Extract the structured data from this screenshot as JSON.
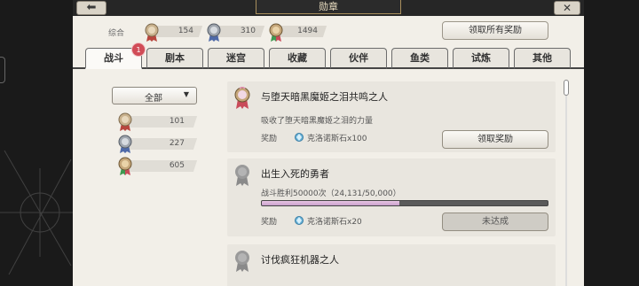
{
  "header": {
    "title": "勋章",
    "back_glyph": "⬅",
    "close_glyph": "✕"
  },
  "summary": {
    "label": "综合",
    "items": [
      {
        "medal": "bronze-medal-icon",
        "value": "154"
      },
      {
        "medal": "silver-medal-icon",
        "value": "310"
      },
      {
        "medal": "gold-medal-icon",
        "value": "1494"
      }
    ],
    "claim_all_label": "领取所有奖励"
  },
  "tabs": [
    {
      "label": "战斗",
      "active": true
    },
    {
      "label": "剧本"
    },
    {
      "label": "迷宫"
    },
    {
      "label": "收藏"
    },
    {
      "label": "伙伴"
    },
    {
      "label": "鱼类"
    },
    {
      "label": "试炼"
    },
    {
      "label": "其他"
    }
  ],
  "badge": {
    "count": "1"
  },
  "filter": {
    "selected": "全部",
    "arrow": "▼"
  },
  "counts": [
    {
      "medal": "bronze-medal-icon",
      "value": "101"
    },
    {
      "medal": "silver-medal-icon",
      "value": "227"
    },
    {
      "medal": "gold-medal-icon",
      "value": "605"
    }
  ],
  "achievements": [
    {
      "title": "与堕天暗黑魔姬之泪共鸣之人",
      "description": "吸收了堕天暗黑魔姬之泪的力量",
      "reward_label": "奖励",
      "reward": "克洛诺斯石x100",
      "button": "领取奖励",
      "progress": null
    },
    {
      "title": "出生入死的勇者",
      "description": "战斗胜利50000次（24,131/50,000）",
      "reward_label": "奖励",
      "reward": "克洛诺斯石x20",
      "button": "未达成",
      "progress": 0.48
    },
    {
      "title": "讨伐疯狂机器之人"
    }
  ],
  "colors": {
    "accent_pink": "#c9a0cc",
    "badge_red": "#d14c57",
    "panel": "#f2efe8"
  }
}
